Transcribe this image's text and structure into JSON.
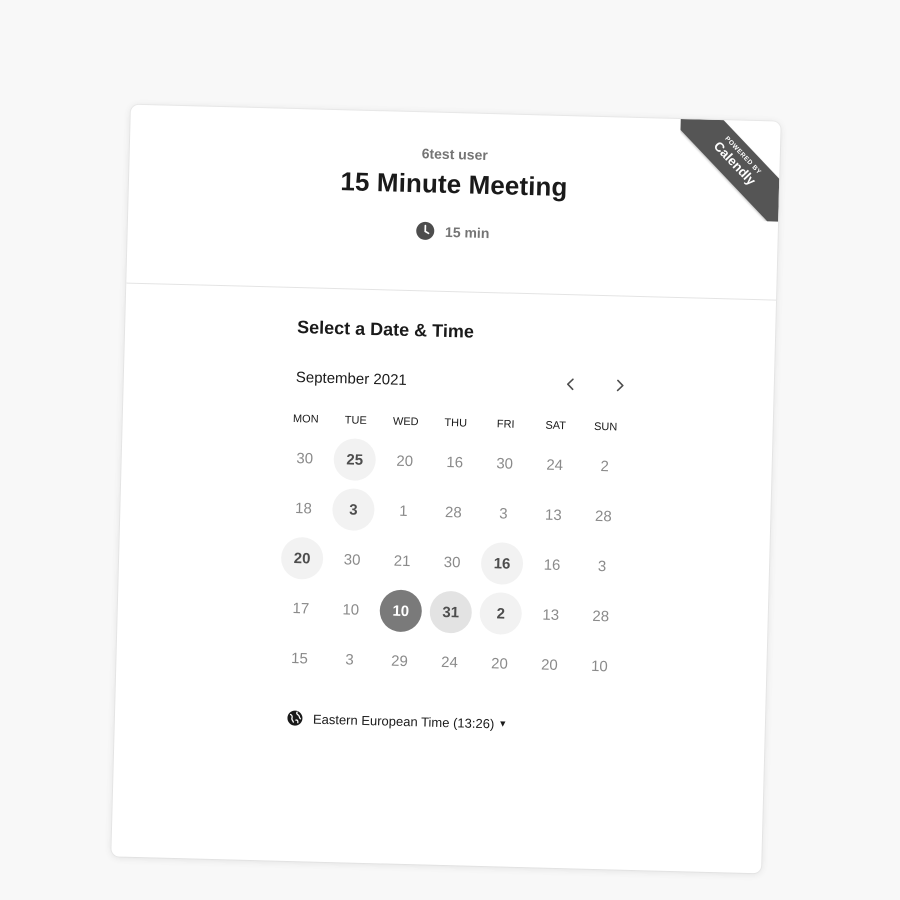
{
  "header": {
    "host_name": "6test user",
    "event_title": "15 Minute Meeting",
    "duration": "15 min",
    "ribbon_top": "POWERED BY",
    "ribbon_brand": "Calendly"
  },
  "scheduler": {
    "section_title": "Select a Date & Time",
    "month": "September 2021",
    "weekdays": [
      "MON",
      "TUE",
      "WED",
      "THU",
      "FRI",
      "SAT",
      "SUN"
    ],
    "weeks": [
      [
        {
          "d": "30",
          "s": "n"
        },
        {
          "d": "25",
          "s": "a"
        },
        {
          "d": "20",
          "s": "n"
        },
        {
          "d": "16",
          "s": "n"
        },
        {
          "d": "30",
          "s": "n"
        },
        {
          "d": "24",
          "s": "n"
        },
        {
          "d": "2",
          "s": "n"
        }
      ],
      [
        {
          "d": "18",
          "s": "n"
        },
        {
          "d": "3",
          "s": "a"
        },
        {
          "d": "1",
          "s": "n"
        },
        {
          "d": "28",
          "s": "n"
        },
        {
          "d": "3",
          "s": "n"
        },
        {
          "d": "13",
          "s": "n"
        },
        {
          "d": "28",
          "s": "n"
        }
      ],
      [
        {
          "d": "20",
          "s": "a"
        },
        {
          "d": "30",
          "s": "n"
        },
        {
          "d": "21",
          "s": "n"
        },
        {
          "d": "30",
          "s": "n"
        },
        {
          "d": "16",
          "s": "a"
        },
        {
          "d": "16",
          "s": "n"
        },
        {
          "d": "3",
          "s": "n"
        }
      ],
      [
        {
          "d": "17",
          "s": "n"
        },
        {
          "d": "10",
          "s": "n"
        },
        {
          "d": "10",
          "s": "sel"
        },
        {
          "d": "31",
          "s": "sl"
        },
        {
          "d": "2",
          "s": "a"
        },
        {
          "d": "13",
          "s": "n"
        },
        {
          "d": "28",
          "s": "n"
        }
      ],
      [
        {
          "d": "15",
          "s": "n"
        },
        {
          "d": "3",
          "s": "n"
        },
        {
          "d": "29",
          "s": "n"
        },
        {
          "d": "24",
          "s": "n"
        },
        {
          "d": "20",
          "s": "n"
        },
        {
          "d": "20",
          "s": "n"
        },
        {
          "d": "10",
          "s": "n"
        }
      ]
    ],
    "timezone_label": "Eastern European Time",
    "timezone_time": "(13:26)"
  },
  "icons": {
    "clock": "clock-icon",
    "prev": "chevron-left-icon",
    "next": "chevron-right-icon",
    "globe": "globe-icon",
    "caret": "caret-down-icon"
  },
  "colors": {
    "selected_day": "#7a7a7a",
    "available_day": "#f2f2f2",
    "ribbon": "#555555"
  }
}
